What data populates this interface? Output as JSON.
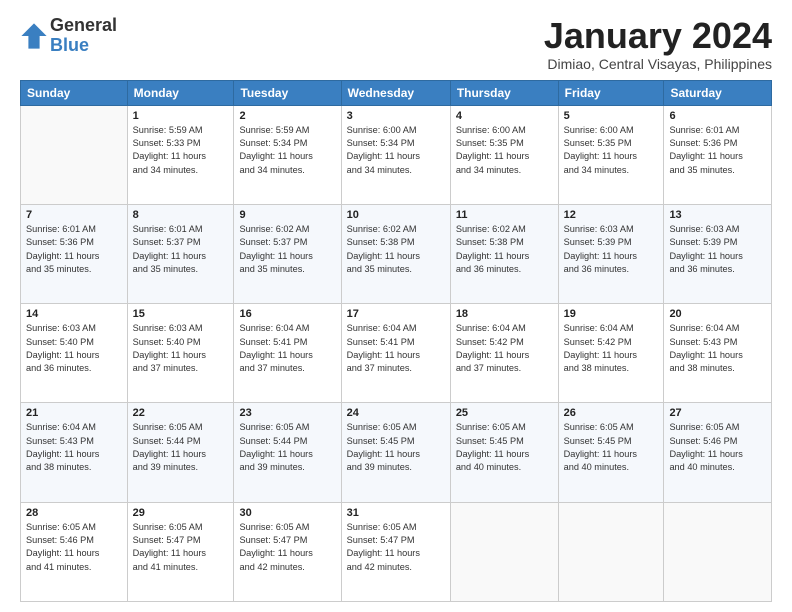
{
  "logo": {
    "general": "General",
    "blue": "Blue"
  },
  "title": "January 2024",
  "location": "Dimiao, Central Visayas, Philippines",
  "weekdays": [
    "Sunday",
    "Monday",
    "Tuesday",
    "Wednesday",
    "Thursday",
    "Friday",
    "Saturday"
  ],
  "weeks": [
    [
      {
        "day": "",
        "info": ""
      },
      {
        "day": "1",
        "info": "Sunrise: 5:59 AM\nSunset: 5:33 PM\nDaylight: 11 hours\nand 34 minutes."
      },
      {
        "day": "2",
        "info": "Sunrise: 5:59 AM\nSunset: 5:34 PM\nDaylight: 11 hours\nand 34 minutes."
      },
      {
        "day": "3",
        "info": "Sunrise: 6:00 AM\nSunset: 5:34 PM\nDaylight: 11 hours\nand 34 minutes."
      },
      {
        "day": "4",
        "info": "Sunrise: 6:00 AM\nSunset: 5:35 PM\nDaylight: 11 hours\nand 34 minutes."
      },
      {
        "day": "5",
        "info": "Sunrise: 6:00 AM\nSunset: 5:35 PM\nDaylight: 11 hours\nand 34 minutes."
      },
      {
        "day": "6",
        "info": "Sunrise: 6:01 AM\nSunset: 5:36 PM\nDaylight: 11 hours\nand 35 minutes."
      }
    ],
    [
      {
        "day": "7",
        "info": "Sunrise: 6:01 AM\nSunset: 5:36 PM\nDaylight: 11 hours\nand 35 minutes."
      },
      {
        "day": "8",
        "info": "Sunrise: 6:01 AM\nSunset: 5:37 PM\nDaylight: 11 hours\nand 35 minutes."
      },
      {
        "day": "9",
        "info": "Sunrise: 6:02 AM\nSunset: 5:37 PM\nDaylight: 11 hours\nand 35 minutes."
      },
      {
        "day": "10",
        "info": "Sunrise: 6:02 AM\nSunset: 5:38 PM\nDaylight: 11 hours\nand 35 minutes."
      },
      {
        "day": "11",
        "info": "Sunrise: 6:02 AM\nSunset: 5:38 PM\nDaylight: 11 hours\nand 36 minutes."
      },
      {
        "day": "12",
        "info": "Sunrise: 6:03 AM\nSunset: 5:39 PM\nDaylight: 11 hours\nand 36 minutes."
      },
      {
        "day": "13",
        "info": "Sunrise: 6:03 AM\nSunset: 5:39 PM\nDaylight: 11 hours\nand 36 minutes."
      }
    ],
    [
      {
        "day": "14",
        "info": "Sunrise: 6:03 AM\nSunset: 5:40 PM\nDaylight: 11 hours\nand 36 minutes."
      },
      {
        "day": "15",
        "info": "Sunrise: 6:03 AM\nSunset: 5:40 PM\nDaylight: 11 hours\nand 37 minutes."
      },
      {
        "day": "16",
        "info": "Sunrise: 6:04 AM\nSunset: 5:41 PM\nDaylight: 11 hours\nand 37 minutes."
      },
      {
        "day": "17",
        "info": "Sunrise: 6:04 AM\nSunset: 5:41 PM\nDaylight: 11 hours\nand 37 minutes."
      },
      {
        "day": "18",
        "info": "Sunrise: 6:04 AM\nSunset: 5:42 PM\nDaylight: 11 hours\nand 37 minutes."
      },
      {
        "day": "19",
        "info": "Sunrise: 6:04 AM\nSunset: 5:42 PM\nDaylight: 11 hours\nand 38 minutes."
      },
      {
        "day": "20",
        "info": "Sunrise: 6:04 AM\nSunset: 5:43 PM\nDaylight: 11 hours\nand 38 minutes."
      }
    ],
    [
      {
        "day": "21",
        "info": "Sunrise: 6:04 AM\nSunset: 5:43 PM\nDaylight: 11 hours\nand 38 minutes."
      },
      {
        "day": "22",
        "info": "Sunrise: 6:05 AM\nSunset: 5:44 PM\nDaylight: 11 hours\nand 39 minutes."
      },
      {
        "day": "23",
        "info": "Sunrise: 6:05 AM\nSunset: 5:44 PM\nDaylight: 11 hours\nand 39 minutes."
      },
      {
        "day": "24",
        "info": "Sunrise: 6:05 AM\nSunset: 5:45 PM\nDaylight: 11 hours\nand 39 minutes."
      },
      {
        "day": "25",
        "info": "Sunrise: 6:05 AM\nSunset: 5:45 PM\nDaylight: 11 hours\nand 40 minutes."
      },
      {
        "day": "26",
        "info": "Sunrise: 6:05 AM\nSunset: 5:45 PM\nDaylight: 11 hours\nand 40 minutes."
      },
      {
        "day": "27",
        "info": "Sunrise: 6:05 AM\nSunset: 5:46 PM\nDaylight: 11 hours\nand 40 minutes."
      }
    ],
    [
      {
        "day": "28",
        "info": "Sunrise: 6:05 AM\nSunset: 5:46 PM\nDaylight: 11 hours\nand 41 minutes."
      },
      {
        "day": "29",
        "info": "Sunrise: 6:05 AM\nSunset: 5:47 PM\nDaylight: 11 hours\nand 41 minutes."
      },
      {
        "day": "30",
        "info": "Sunrise: 6:05 AM\nSunset: 5:47 PM\nDaylight: 11 hours\nand 42 minutes."
      },
      {
        "day": "31",
        "info": "Sunrise: 6:05 AM\nSunset: 5:47 PM\nDaylight: 11 hours\nand 42 minutes."
      },
      {
        "day": "",
        "info": ""
      },
      {
        "day": "",
        "info": ""
      },
      {
        "day": "",
        "info": ""
      }
    ]
  ]
}
